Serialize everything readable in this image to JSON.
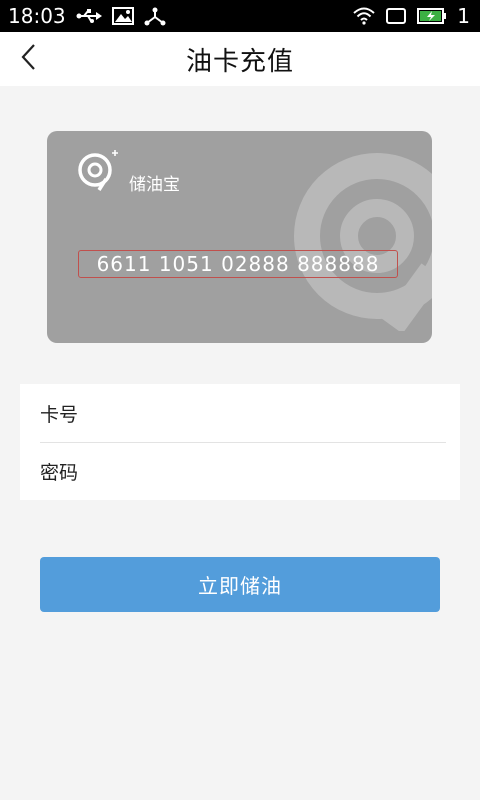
{
  "status_bar": {
    "time": "18:03",
    "battery_level": "1",
    "icons": [
      "usb-icon",
      "image-icon",
      "share-icon",
      "wifi-icon",
      "screen-icon",
      "battery-icon"
    ]
  },
  "nav": {
    "title": "油卡充值",
    "back_icon": "chevron-left-icon"
  },
  "card": {
    "brand_name": "储油宝",
    "card_number": "6611 1051 02888 888888",
    "background_color": "#a0a0a0",
    "number_border_color": "#c0504d"
  },
  "form": {
    "card_label": "卡号",
    "password_label": "密码",
    "card_value": "",
    "password_value": ""
  },
  "submit": {
    "label": "立即储油",
    "color": "#539ddb"
  }
}
